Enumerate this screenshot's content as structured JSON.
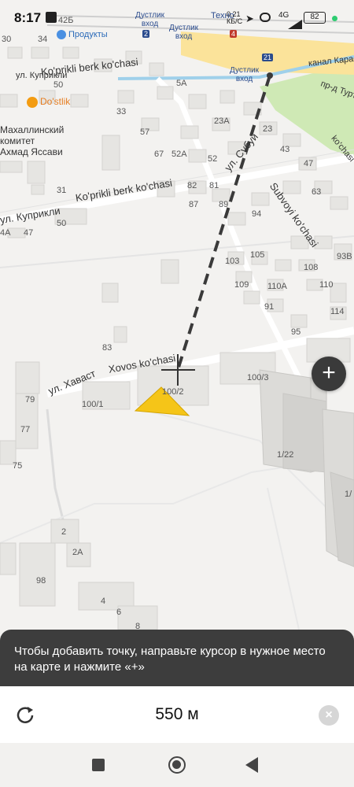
{
  "status_bar": {
    "time": "8:17",
    "data_speed": "0.21\nКБ/С",
    "network": "4G",
    "battery": "82"
  },
  "map": {
    "pois": {
      "produkty": "Продукты",
      "dostlik": "Do'stlik",
      "mahalla": "Махаллинский\nкомитет\nАхмад Яссави"
    },
    "metro": {
      "dustlik_vhod_1": "Дустлик\nвход",
      "dustlik_vhod_2": "Дустлик\nвход",
      "dustlik_vhod_3": "Дустлик\nвход",
      "techno": "Техно",
      "line2": "2",
      "line4": "4",
      "line21": "21"
    },
    "streets": {
      "kuprikli_1": "ул. Куприкли",
      "koprikli_berk_1": "Ko'prikli berk ko'chasi",
      "koprikli_berk_2": "Ko'prikli berk ko'chasi",
      "kuprikli_2": "ул. Куприкли",
      "subuy": "ул. Субуй",
      "subvoyi": "Subvoyi ko'chasi",
      "havast": "ул. Хаваст",
      "xovos": "Xovos ko'chasi",
      "karasu": "канал Карасу",
      "turt": "пр-д Турт",
      "kochasi": "ko'chasi"
    },
    "house_numbers": [
      "30",
      "34",
      "50",
      "42Б",
      "5А",
      "33",
      "57",
      "67",
      "52А",
      "52",
      "23А",
      "23",
      "43",
      "47",
      "63",
      "31",
      "82",
      "81",
      "87",
      "89",
      "94",
      "50",
      "47",
      "4А",
      "103",
      "105",
      "108",
      "93В",
      "109",
      "110А",
      "110",
      "91",
      "114",
      "95",
      "83",
      "100/2",
      "100/3",
      "100/1",
      "79",
      "77",
      "75",
      "1/22",
      "2",
      "2А",
      "98",
      "4",
      "6",
      "8",
      "1/"
    ],
    "measure_line_distance": "550 м"
  },
  "hint": {
    "text": "Чтобы добавить точку, направьте курсор в нужное место на карте и нажмите «+»"
  },
  "controls": {
    "zoom_in_label": "+",
    "distance": "550 м",
    "close_label": "×"
  },
  "colors": {
    "accent_arrow": "#f5c518",
    "hint_bg": "#3d3d3d",
    "park_green": "#cfe9b5",
    "road_yellow": "#fbe39a"
  }
}
